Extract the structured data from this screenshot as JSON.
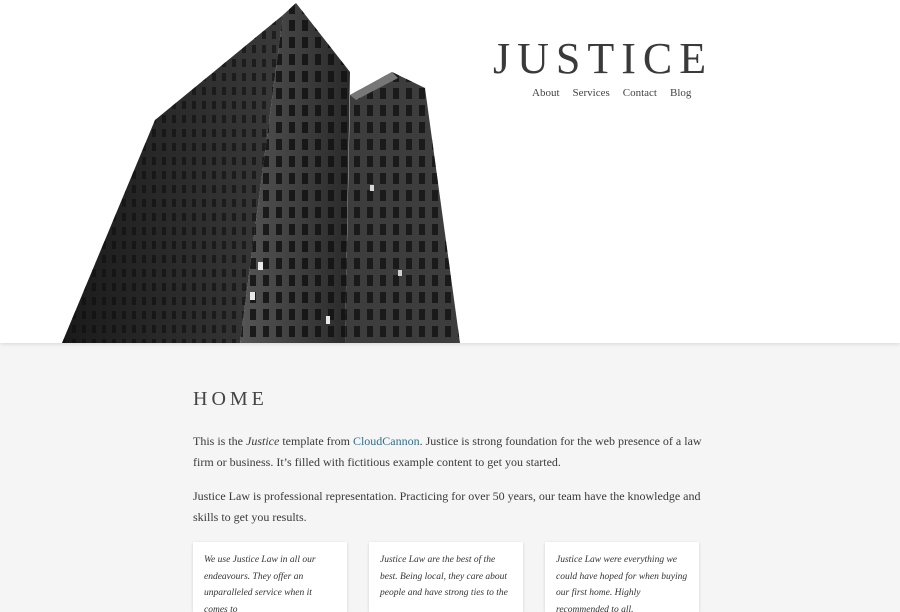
{
  "header": {
    "logo": "JUSTICE",
    "nav": [
      "About",
      "Services",
      "Contact",
      "Blog"
    ]
  },
  "hero_image": {
    "alt": "building-photo"
  },
  "main": {
    "title": "HOME",
    "intro_parts": {
      "a": "This is the ",
      "em": "Justice",
      "b": " template from ",
      "link": "CloudCannon",
      "c": ". Justice is strong foundation for the web presence of a law firm or business. It’s filled with fictitious example content to get you started."
    },
    "para2": "Justice Law is professional representation. Practicing for over 50 years, our team have the knowledge and skills to get you results."
  },
  "testimonials": [
    "We use Justice Law in all our endeavours. They offer an unparalleled service when it comes to",
    "Justice Law are the best of the best. Being local, they care about people and have strong ties to the",
    "Justice Law were everything we could have hoped for when buying our first home. Highly recommended to all."
  ]
}
